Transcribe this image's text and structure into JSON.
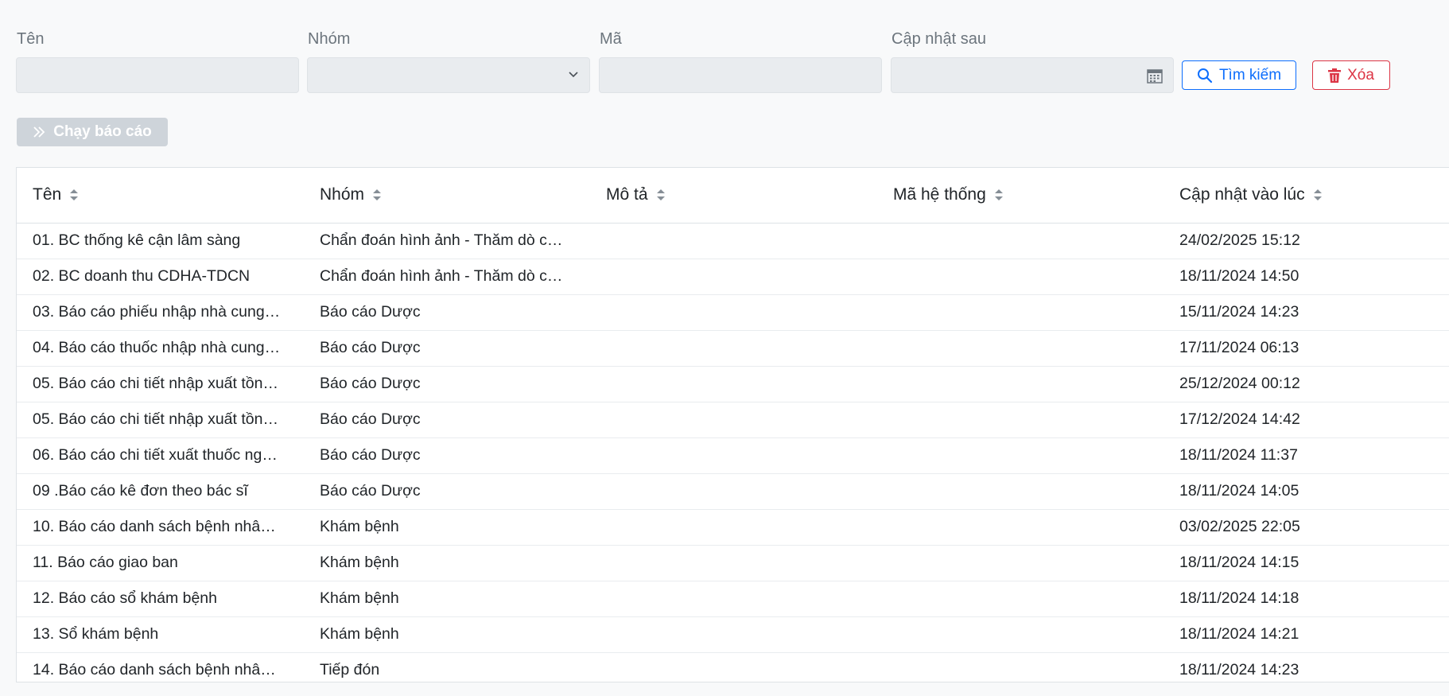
{
  "filters": {
    "name_label": "Tên",
    "group_label": "Nhóm",
    "code_label": "Mã",
    "updated_after_label": "Cập nhật sau",
    "name_value": "",
    "group_value": "",
    "code_value": "",
    "updated_after_value": ""
  },
  "buttons": {
    "search": "Tìm kiếm",
    "clear": "Xóa",
    "run_report": "Chạy báo cáo"
  },
  "colors": {
    "primary": "#0d6efd",
    "danger": "#dc3545",
    "disabled": "#ced4da"
  },
  "table": {
    "columns": [
      "Tên",
      "Nhóm",
      "Mô tả",
      "Mã hệ thống",
      "Cập nhật vào lúc"
    ],
    "rows": [
      {
        "name": "01. BC thống kê cận lâm sàng",
        "group": "Chẩn đoán hình ảnh - Thăm dò c…",
        "desc": "",
        "code": "",
        "updated": "24/02/2025 15:12"
      },
      {
        "name": "02. BC doanh thu CDHA-TDCN",
        "group": "Chẩn đoán hình ảnh - Thăm dò c…",
        "desc": "",
        "code": "",
        "updated": "18/11/2024 14:50"
      },
      {
        "name": "03. Báo cáo phiếu nhập nhà cung…",
        "group": "Báo cáo Dược",
        "desc": "",
        "code": "",
        "updated": "15/11/2024 14:23"
      },
      {
        "name": "04. Báo cáo thuốc nhập nhà cung…",
        "group": "Báo cáo Dược",
        "desc": "",
        "code": "",
        "updated": "17/11/2024 06:13"
      },
      {
        "name": "05. Báo cáo chi tiết nhập xuất tồn…",
        "group": "Báo cáo Dược",
        "desc": "",
        "code": "",
        "updated": "25/12/2024 00:12"
      },
      {
        "name": "05. Báo cáo chi tiết nhập xuất tồn…",
        "group": "Báo cáo Dược",
        "desc": "",
        "code": "",
        "updated": "17/12/2024 14:42"
      },
      {
        "name": "06. Báo cáo chi tiết xuất thuốc ng…",
        "group": "Báo cáo Dược",
        "desc": "",
        "code": "",
        "updated": "18/11/2024 11:37"
      },
      {
        "name": "09 .Báo cáo kê đơn theo bác sĩ",
        "group": "Báo cáo Dược",
        "desc": "",
        "code": "",
        "updated": "18/11/2024 14:05"
      },
      {
        "name": "10. Báo cáo danh sách bệnh nhâ…",
        "group": "Khám bệnh",
        "desc": "",
        "code": "",
        "updated": "03/02/2025 22:05"
      },
      {
        "name": "11. Báo cáo giao ban",
        "group": "Khám bệnh",
        "desc": "",
        "code": "",
        "updated": "18/11/2024 14:15"
      },
      {
        "name": "12. Báo cáo sổ khám bệnh",
        "group": "Khám bệnh",
        "desc": "",
        "code": "",
        "updated": "18/11/2024 14:18"
      },
      {
        "name": "13. Sổ khám bệnh",
        "group": "Khám bệnh",
        "desc": "",
        "code": "",
        "updated": "18/11/2024 14:21"
      },
      {
        "name": "14. Báo cáo danh sách bệnh nhâ…",
        "group": "Tiếp đón",
        "desc": "",
        "code": "",
        "updated": "18/11/2024 14:23"
      }
    ]
  }
}
